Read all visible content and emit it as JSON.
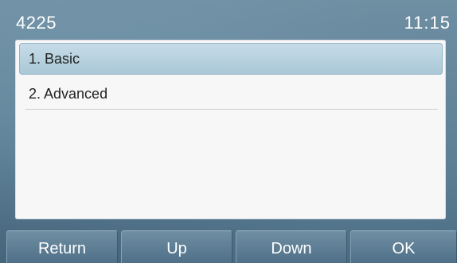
{
  "status_bar": {
    "extension": "4225",
    "time": "11:15"
  },
  "menu": {
    "items": [
      {
        "label": "1. Basic",
        "selected": true
      },
      {
        "label": "2. Advanced",
        "selected": false
      }
    ]
  },
  "softkeys": [
    {
      "label": "Return"
    },
    {
      "label": "Up"
    },
    {
      "label": "Down"
    },
    {
      "label": "OK"
    }
  ],
  "colors": {
    "background": "#5b7d93",
    "panel": "#f7f7f7",
    "selection": "#a9c7d6",
    "text": "#222222"
  }
}
